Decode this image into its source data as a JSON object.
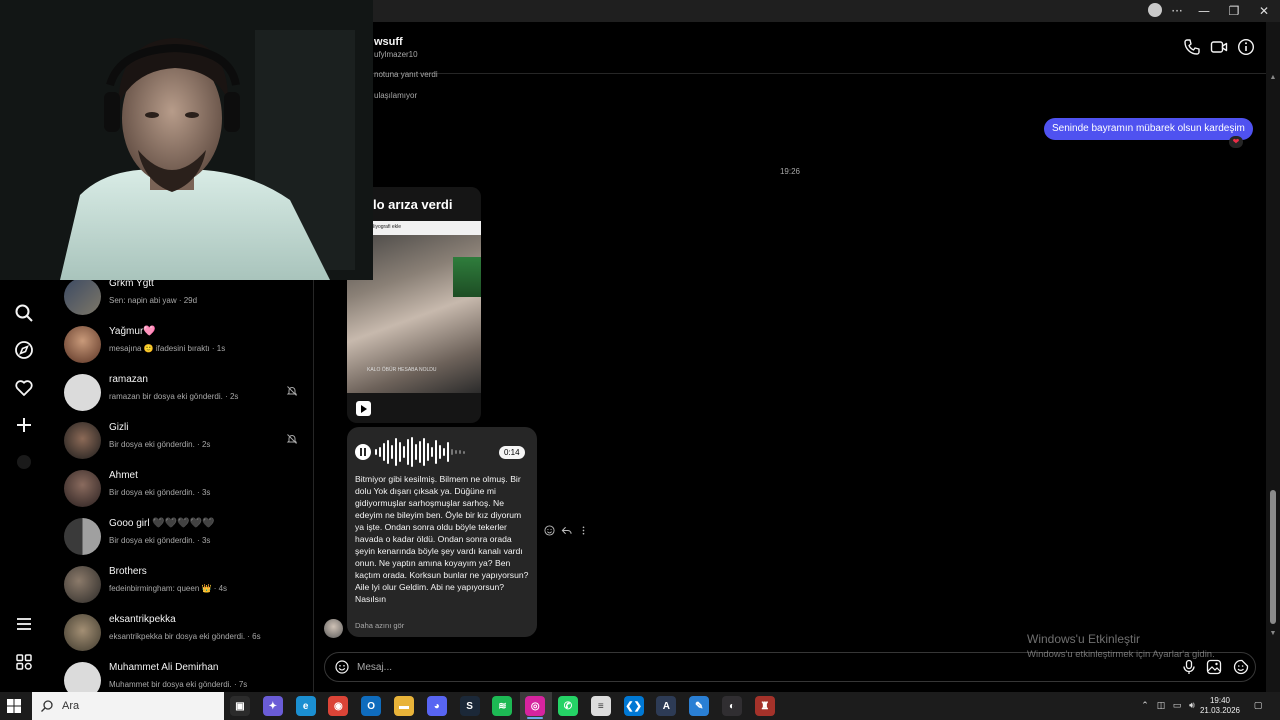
{
  "window": {
    "controls": {
      "more": "···",
      "minimize": "—",
      "restore": "❐",
      "close": "✕"
    }
  },
  "conversations": [
    {
      "name": "Grkm Ygtt",
      "preview": "Sen: napin abi yaw · 29d",
      "muted": false
    },
    {
      "name": "Yağmur🩷",
      "preview": "mesajına 🙂 ifadesini bıraktı · 1s",
      "muted": false
    },
    {
      "name": "ramazan",
      "preview": "ramazan bir dosya eki gönderdi. · 2s",
      "muted": true
    },
    {
      "name": "Gizli",
      "preview": "Bir dosya eki gönderdin. · 2s",
      "muted": true
    },
    {
      "name": "Ahmet",
      "preview": "Bir dosya eki gönderdin. · 3s",
      "muted": false
    },
    {
      "name": "Gooo girl 🖤🖤🖤🖤🖤",
      "preview": "Bir dosya eki gönderdin. · 3s",
      "muted": false
    },
    {
      "name": "Brothers",
      "preview": "fedeinbirmingham: queen 👑 · 4s",
      "muted": false
    },
    {
      "name": "eksantrikpekka",
      "preview": "eksantrikpekka bir dosya eki gönderdi. · 6s",
      "muted": false
    },
    {
      "name": "Muhammet Ali Demirhan",
      "preview": "Muhammet bir dosya eki gönderdi. · 7s",
      "muted": false
    }
  ],
  "chat": {
    "name": "wsuff",
    "handle": "ufylmazer10",
    "system_lines": [
      "notuna yanıt verdi",
      "ulaşılamıyor"
    ],
    "sent_message": "Seninde bayramın mübarek olsun kardeşim",
    "reaction": "❤",
    "timestamp": "19:26",
    "reel": {
      "title": "lo arıza verdi",
      "strip_text": "Biyografi ekle",
      "caption": "KALO ÖBÜR HESABA NOLDU"
    },
    "voice": {
      "duration": "0:14",
      "transcript": "Bitmiyor gibi kesilmiş. Bilmem ne olmuş. Bir dolu Yok dışarı çıksak ya. Düğüne mi gidiyormuşlar sarhoşmuşlar sarhoş. Ne edeyim ne bileyim ben. Öyle bir kız diyorum ya işte. Ondan sonra oldu böyle tekerler havada o kadar öldü. Ondan sonra orada şeyin kenarında böyle şey vardı kanalı vardı onun. Ne yaptın amına koyayım ya? Ben kaçtım orada. Korksun bunlar ne yapıyorsun? Aile lyi olur Geldim. Abi ne yapıyorsun? Nasılsın",
      "show_less": "Daha azını gör"
    },
    "composer_placeholder": "Mesaj..."
  },
  "watermark": {
    "line1": "Windows'u Etkinleştir",
    "line2": "Windows'u etkinleştirmek için Ayarlar'a gidin."
  },
  "taskbar": {
    "search_placeholder": "Ara",
    "time": "19:40",
    "date": "21.03.2026",
    "apps": [
      {
        "name": "task-view",
        "color": "#2b2b2b",
        "glyph": "▣"
      },
      {
        "name": "copilot",
        "color": "#6a5cd6",
        "glyph": "✦"
      },
      {
        "name": "edge",
        "color": "#1b8fd1",
        "glyph": "e"
      },
      {
        "name": "chrome",
        "color": "#db4437",
        "glyph": "◉"
      },
      {
        "name": "outlook",
        "color": "#0f6cbd",
        "glyph": "O"
      },
      {
        "name": "file-explorer",
        "color": "#e8b339",
        "glyph": "▬"
      },
      {
        "name": "discord",
        "color": "#5865f2",
        "glyph": "◕"
      },
      {
        "name": "steam",
        "color": "#1b2838",
        "glyph": "S"
      },
      {
        "name": "spotify",
        "color": "#1db954",
        "glyph": "≋"
      },
      {
        "name": "instagram",
        "color": "#d6249f",
        "glyph": "◎"
      },
      {
        "name": "whatsapp",
        "color": "#25d366",
        "glyph": "✆"
      },
      {
        "name": "notepad",
        "color": "#dcdcdc",
        "glyph": "≡"
      },
      {
        "name": "vscode",
        "color": "#0078d4",
        "glyph": "❮❯"
      },
      {
        "name": "arch-app",
        "color": "#2d3b55",
        "glyph": "A"
      },
      {
        "name": "paint",
        "color": "#2a7fd4",
        "glyph": "✎"
      },
      {
        "name": "obs",
        "color": "#302e31",
        "glyph": "◐"
      },
      {
        "name": "game-app",
        "color": "#a4322a",
        "glyph": "♜"
      }
    ]
  },
  "colors": {
    "accent": "#4f52f0",
    "background": "#000000",
    "bubble_received": "#262626",
    "muted_text": "#a8a8a8"
  }
}
